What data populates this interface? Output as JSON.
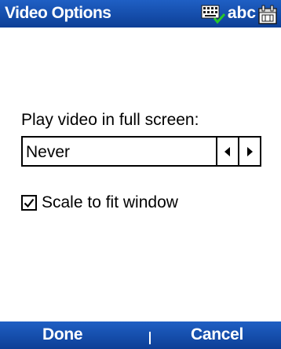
{
  "titlebar": {
    "title": "Video Options",
    "status": {
      "input_mode_text": "abc",
      "icons": [
        "keyboard-icon",
        "calendar-icon"
      ]
    }
  },
  "content": {
    "prompt": "Play video in full screen:",
    "spinner": {
      "value": "Never"
    },
    "scale_checkbox": {
      "label": "Scale to fit window",
      "checked": true
    }
  },
  "softkeys": {
    "left": "Done",
    "right": "Cancel"
  },
  "colors": {
    "bar": "#1f5fc4",
    "text": "#000000",
    "background": "#ffffff"
  }
}
